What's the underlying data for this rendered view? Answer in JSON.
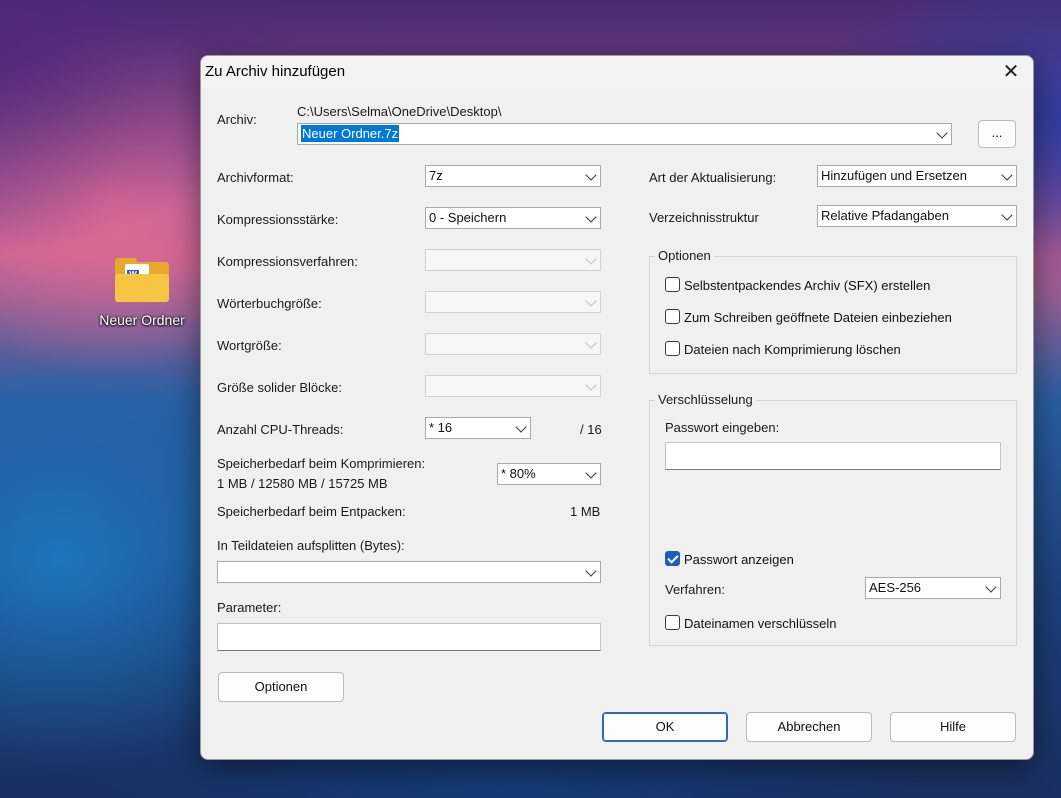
{
  "desktop": {
    "icon_label": "Neuer Ordner",
    "icon_badge": "W"
  },
  "dialog": {
    "title": "Zu Archiv hinzufügen",
    "close_glyph": "✕",
    "archive": {
      "label": "Archiv:",
      "path": "C:\\Users\\Selma\\OneDrive\\Desktop\\",
      "name": "Neuer Ordner.7z",
      "browse_label": "..."
    },
    "left": {
      "format": {
        "label": "Archivformat:",
        "value": "7z"
      },
      "level": {
        "label": "Kompressionsstärke:",
        "value": "0 - Speichern"
      },
      "method": {
        "label": "Kompressionsverfahren:",
        "value": ""
      },
      "dict": {
        "label": "Wörterbuchgröße:",
        "value": ""
      },
      "word": {
        "label": "Wortgröße:",
        "value": ""
      },
      "solid": {
        "label": "Größe solider Blöcke:",
        "value": ""
      },
      "threads": {
        "label": "Anzahl CPU-Threads:",
        "value": "* 16",
        "max": "/ 16"
      },
      "mem_compress": {
        "label": "Speicherbedarf beim Komprimieren:",
        "detail": "1 MB / 12580 MB / 15725 MB",
        "value": "* 80%"
      },
      "mem_decompress": {
        "label": "Speicherbedarf beim Entpacken:",
        "value": "1 MB"
      },
      "split": {
        "label": "In Teildateien aufsplitten (Bytes):",
        "value": ""
      },
      "params": {
        "label": "Parameter:",
        "value": ""
      },
      "options_button": "Optionen"
    },
    "right": {
      "update": {
        "label": "Art der Aktualisierung:",
        "value": "Hinzufügen und Ersetzen"
      },
      "pathmode": {
        "label": "Verzeichnisstruktur",
        "value": "Relative Pfadangaben"
      },
      "options": {
        "title": "Optionen",
        "sfx": {
          "label": "Selbstentpackendes Archiv (SFX) erstellen",
          "checked": false
        },
        "shared": {
          "label": "Zum Schreiben geöffnete Dateien einbeziehen",
          "checked": false
        },
        "delete": {
          "label": "Dateien nach Komprimierung löschen",
          "checked": false
        }
      },
      "encryption": {
        "title": "Verschlüsselung",
        "password_label": "Passwort eingeben:",
        "password_value": "",
        "show_password": {
          "label": "Passwort anzeigen",
          "checked": true
        },
        "method_label": "Verfahren:",
        "method_value": "AES-256",
        "encrypt_names": {
          "label": "Dateinamen verschlüsseln",
          "checked": false
        }
      }
    },
    "buttons": {
      "ok": "OK",
      "cancel": "Abbrechen",
      "help": "Hilfe"
    }
  }
}
